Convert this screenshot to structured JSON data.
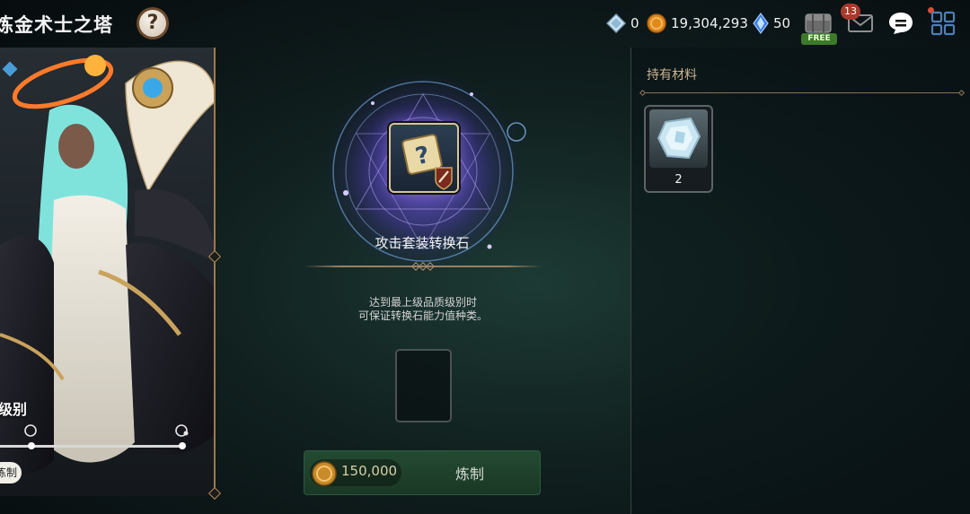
{
  "header": {
    "title": "炼金术士之塔",
    "help_symbol": "?"
  },
  "currencies": {
    "diamond": "0",
    "gold": "19,304,293",
    "crystal": "50"
  },
  "notifications": {
    "mail_count": "13",
    "free_label": "FREE"
  },
  "character_panel": {
    "grade_label": "级别",
    "refine_chip": "炼制"
  },
  "center": {
    "item_name": "攻击套装转换石",
    "item_symbol": "?",
    "description_line1": "达到最上级品质级别时",
    "description_line2": "可保证转换石能力值种类。",
    "craft_cost": "150,000",
    "craft_label": "炼制"
  },
  "inventory": {
    "title": "持有材料",
    "items": [
      {
        "quantity": "2"
      }
    ]
  },
  "colors": {
    "accent_gold": "#cdb58e",
    "craft_green": "#244a32",
    "badge_red": "#a83a2b"
  }
}
